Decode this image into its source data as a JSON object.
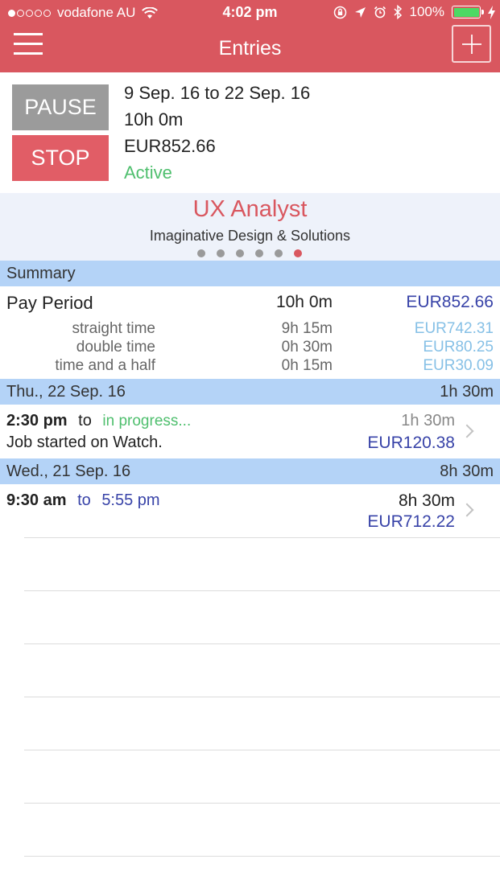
{
  "status_bar": {
    "carrier": "vodafone AU",
    "time": "4:02 pm",
    "battery": "100%",
    "signal_bars_filled": 1,
    "signal_bars_total": 5,
    "battery_level": 1.0
  },
  "nav": {
    "title": "Entries",
    "menu_icon": "hamburger-menu-icon",
    "add_icon": "plus-icon"
  },
  "timer": {
    "pause_label": "PAUSE",
    "stop_label": "STOP",
    "date_range": "9 Sep. 16 to 22 Sep. 16",
    "duration": "10h 0m",
    "amount": "EUR852.66",
    "status": "Active"
  },
  "job": {
    "title": "UX Analyst",
    "client": "Imaginative Design & Solutions",
    "page_count": 6,
    "active_page": 6
  },
  "summary": {
    "header": "Summary",
    "pay_period": {
      "label": "Pay Period",
      "time": "10h 0m",
      "amount": "EUR852.66"
    },
    "rows": [
      {
        "label": "straight time",
        "time": "9h 15m",
        "amount": "EUR742.31"
      },
      {
        "label": "double time",
        "time": "0h 30m",
        "amount": "EUR80.25"
      },
      {
        "label": "time and a half",
        "time": "0h 15m",
        "amount": "EUR30.09"
      }
    ]
  },
  "days": [
    {
      "header": "Thu., 22 Sep. 16",
      "total": "1h 30m",
      "entry": {
        "start": "2:30 pm",
        "to": "to",
        "end": "in progress...",
        "note": "Job started on Watch.",
        "duration": "1h 30m",
        "amount": "EUR120.38"
      }
    },
    {
      "header": "Wed., 21 Sep. 16",
      "total": "8h 30m",
      "entry": {
        "start": "9:30 am",
        "to": "to",
        "end": "5:55 pm",
        "note": "",
        "duration": "8h 30m",
        "amount": "EUR712.22"
      }
    }
  ],
  "colors": {
    "brand": "#d9575f",
    "section": "#b4d3f7",
    "active": "#4fbf6e",
    "amount": "#3843a8",
    "amount_light": "#86c0e6"
  }
}
